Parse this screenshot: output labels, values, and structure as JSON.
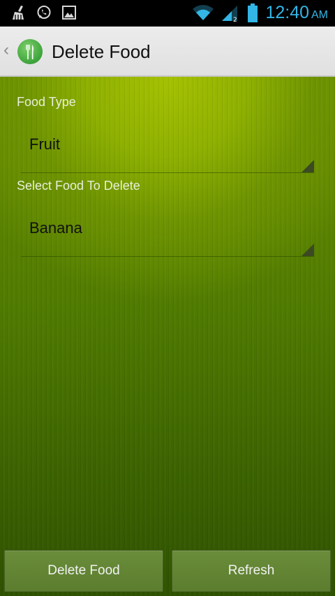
{
  "status_bar": {
    "time": "12:40",
    "ampm": "AM",
    "left_icons": [
      "cleaner-icon",
      "whatsapp-icon",
      "gallery-icon"
    ],
    "right_icons": [
      "wifi-icon",
      "signal-icon",
      "battery-icon"
    ],
    "accent_color": "#33b5e5"
  },
  "action_bar": {
    "title": "Delete Food",
    "up_caret": "‹"
  },
  "form": {
    "food_type_label": "Food Type",
    "food_type_value": "Fruit",
    "select_food_label": "Select Food To Delete",
    "select_food_value": "Banana"
  },
  "buttons": {
    "delete_label": "Delete Food",
    "refresh_label": "Refresh"
  }
}
